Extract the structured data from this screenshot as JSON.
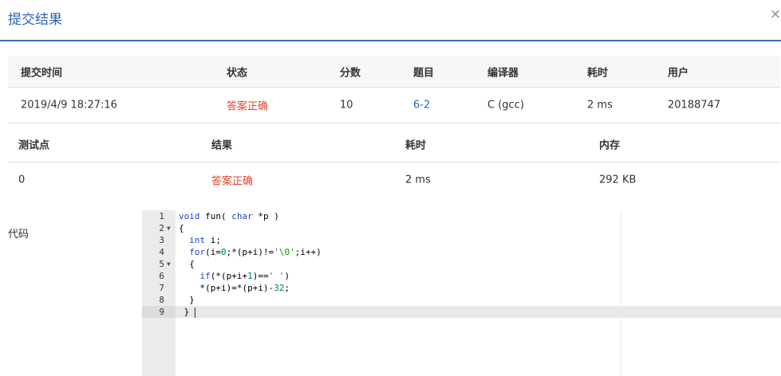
{
  "modal": {
    "title": "提交结果",
    "close_label": "×"
  },
  "submission": {
    "headers": [
      "提交时间",
      "状态",
      "分数",
      "题目",
      "编译器",
      "耗时",
      "用户"
    ],
    "row": {
      "time": "2019/4/9 18:27:16",
      "status": "答案正确",
      "score": "10",
      "problem": "6-2",
      "compiler": "C (gcc)",
      "elapsed": "2 ms",
      "user": "20188747"
    }
  },
  "testcases": {
    "headers": [
      "测试点",
      "结果",
      "耗时",
      "内存"
    ],
    "rows": [
      {
        "id": "0",
        "result": "答案正确",
        "time": "2 ms",
        "memory": "292 KB"
      }
    ]
  },
  "code_section": {
    "label": "代码",
    "line_numbers": [
      "1",
      "2",
      "3",
      "4",
      "5",
      "6",
      "7",
      "8",
      "9"
    ],
    "lines": [
      "void fun( char *p )",
      "{",
      "  int i;",
      "  for(i=0;*(p+i)!='\\0';i++)",
      "  {",
      "    if(*(p+i+1)==' ')",
      "    *(p+i)=*(p+i)-32;",
      "  }",
      " }"
    ]
  },
  "colors": {
    "accent": "#2d64b3",
    "success": "#e0452f",
    "header_bg": "#f7f7f7"
  }
}
